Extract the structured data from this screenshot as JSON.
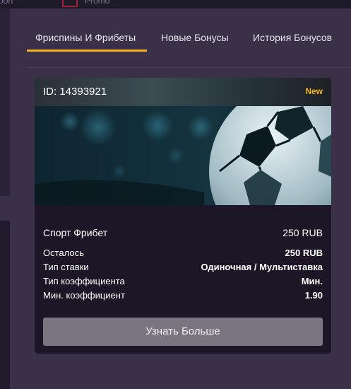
{
  "backdrop": {
    "nav_sport": "port",
    "nav_promo": "Promo"
  },
  "tabs": [
    {
      "label": "Фриспины И Фрибеты",
      "active": true
    },
    {
      "label": "Новые Бонусы",
      "active": false
    },
    {
      "label": "История Бонусов",
      "active": false
    }
  ],
  "card": {
    "id": "ID: 14393921",
    "badge": "New",
    "image": "football-icon",
    "prize_label": "Спорт Фрибет",
    "prize_value": "250 RUB",
    "details": [
      {
        "label": "Осталось",
        "value": "250 RUB"
      },
      {
        "label": "Тип ставки",
        "value": "Одиночная / Мультиставка"
      },
      {
        "label": "Тип коэффициента",
        "value": "Мин."
      },
      {
        "label": "Мин. коэффициент",
        "value": "1.90"
      }
    ],
    "button_label": "Узнать Больше"
  },
  "colors": {
    "accent": "#f2b21d",
    "modal_bg": "#3a3047",
    "card_bg": "#1d1627",
    "button_bg": "#7b7580"
  }
}
